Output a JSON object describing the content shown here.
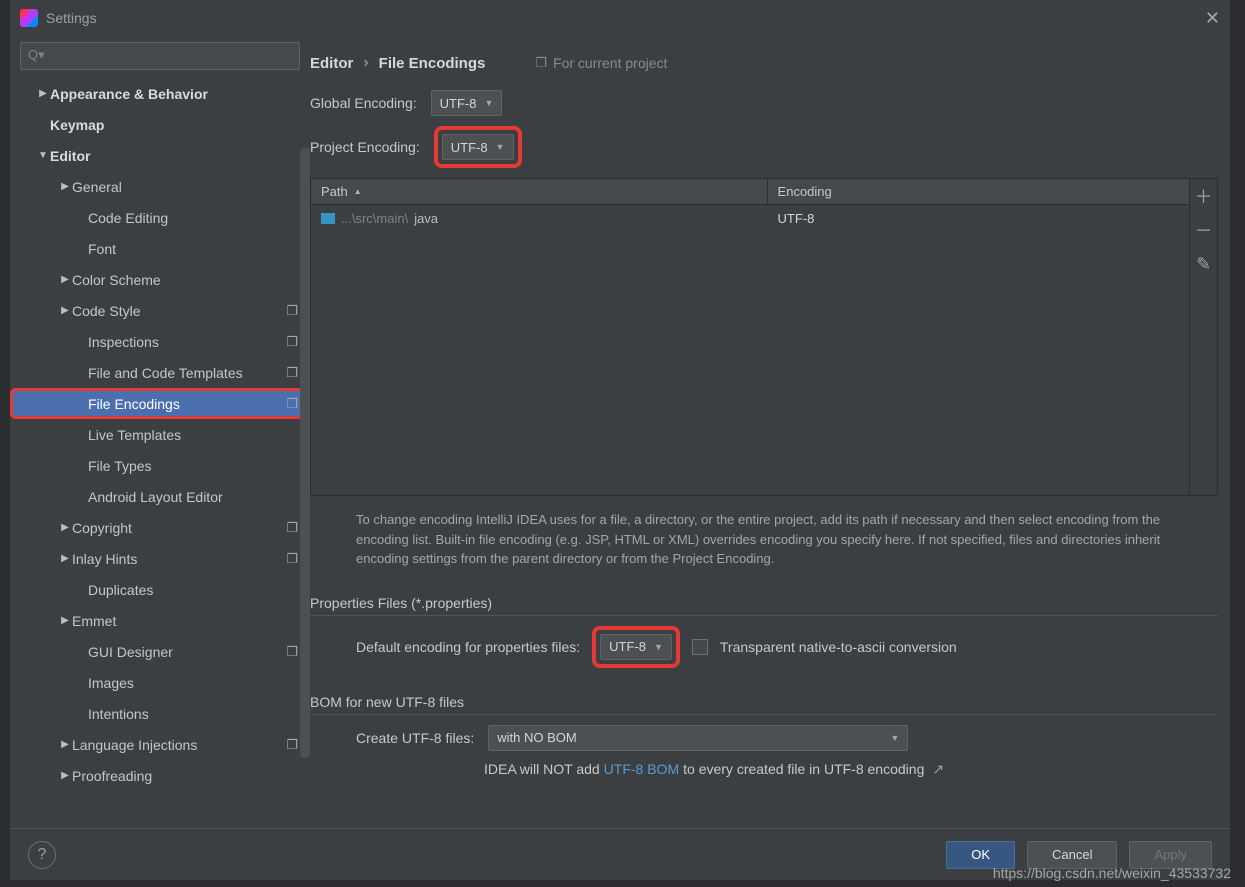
{
  "window": {
    "title": "Settings"
  },
  "sidebar": {
    "search_placeholder": "",
    "items": [
      {
        "label": "Appearance & Behavior",
        "depth": 0,
        "arrow": "▶",
        "bold": true
      },
      {
        "label": "Keymap",
        "depth": 0,
        "arrow": "",
        "bold": true
      },
      {
        "label": "Editor",
        "depth": 0,
        "arrow": "▼",
        "bold": true
      },
      {
        "label": "General",
        "depth": 1,
        "arrow": "▶"
      },
      {
        "label": "Code Editing",
        "depth": 2,
        "arrow": ""
      },
      {
        "label": "Font",
        "depth": 2,
        "arrow": ""
      },
      {
        "label": "Color Scheme",
        "depth": 1,
        "arrow": "▶"
      },
      {
        "label": "Code Style",
        "depth": 1,
        "arrow": "▶",
        "stack": true
      },
      {
        "label": "Inspections",
        "depth": 2,
        "arrow": "",
        "stack": true
      },
      {
        "label": "File and Code Templates",
        "depth": 2,
        "arrow": "",
        "stack": true
      },
      {
        "label": "File Encodings",
        "depth": 2,
        "arrow": "",
        "stack": true,
        "selected": true,
        "highlight": true
      },
      {
        "label": "Live Templates",
        "depth": 2,
        "arrow": ""
      },
      {
        "label": "File Types",
        "depth": 2,
        "arrow": ""
      },
      {
        "label": "Android Layout Editor",
        "depth": 2,
        "arrow": ""
      },
      {
        "label": "Copyright",
        "depth": 1,
        "arrow": "▶",
        "stack": true
      },
      {
        "label": "Inlay Hints",
        "depth": 1,
        "arrow": "▶",
        "stack": true
      },
      {
        "label": "Duplicates",
        "depth": 2,
        "arrow": ""
      },
      {
        "label": "Emmet",
        "depth": 1,
        "arrow": "▶"
      },
      {
        "label": "GUI Designer",
        "depth": 2,
        "arrow": "",
        "stack": true
      },
      {
        "label": "Images",
        "depth": 2,
        "arrow": ""
      },
      {
        "label": "Intentions",
        "depth": 2,
        "arrow": ""
      },
      {
        "label": "Language Injections",
        "depth": 1,
        "arrow": "▶",
        "stack": true
      },
      {
        "label": "Proofreading",
        "depth": 1,
        "arrow": "▶"
      }
    ]
  },
  "breadcrumb": {
    "root": "Editor",
    "leaf": "File Encodings",
    "scope": "For current project"
  },
  "fields": {
    "global_label": "Global Encoding:",
    "global_value": "UTF-8",
    "project_label": "Project Encoding:",
    "project_value": "UTF-8"
  },
  "table": {
    "col_path": "Path",
    "col_enc": "Encoding",
    "rows": [
      {
        "path_prefix": "...\\src\\main\\",
        "path_tail": "java",
        "encoding": "UTF-8"
      }
    ]
  },
  "help": "To change encoding IntelliJ IDEA uses for a file, a directory, or the entire project, add its path if necessary and then select encoding from the encoding list. Built-in file encoding (e.g. JSP, HTML or XML) overrides encoding you specify here. If not specified, files and directories inherit encoding settings from the parent directory or from the Project Encoding.",
  "props": {
    "heading": "Properties Files (*.properties)",
    "default_label": "Default encoding for properties files:",
    "default_value": "UTF-8",
    "checkbox_label": "Transparent native-to-ascii conversion"
  },
  "bom": {
    "heading": "BOM for new UTF-8 files",
    "create_label": "Create UTF-8 files:",
    "create_value": "with NO BOM",
    "note_prefix": "IDEA will NOT add ",
    "note_link": "UTF-8 BOM",
    "note_suffix": " to every created file in UTF-8 encoding"
  },
  "buttons": {
    "ok": "OK",
    "cancel": "Cancel",
    "apply": "Apply"
  },
  "watermark": "https://blog.csdn.net/weixin_43533732"
}
